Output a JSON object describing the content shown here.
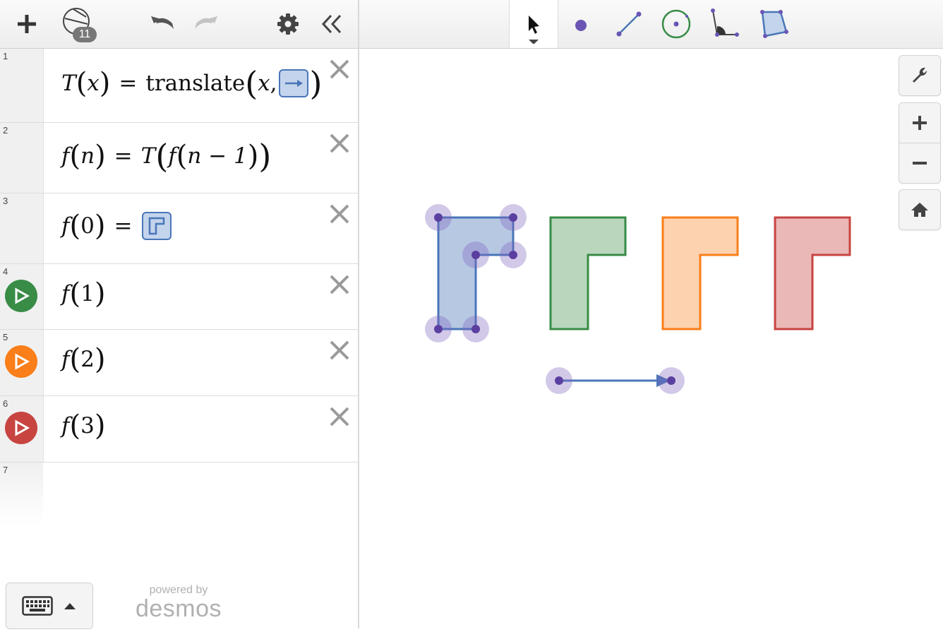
{
  "left_toolbar": {
    "add_icon": "plus-icon",
    "geometry_icon": "geometry-icon",
    "geometry_count": "11",
    "undo_icon": "undo-icon",
    "redo_icon": "redo-icon",
    "settings_icon": "gear-icon",
    "collapse_icon": "double-chevron-left-icon"
  },
  "expressions": [
    {
      "number": "1",
      "f": "T",
      "arg": "x",
      "eq": "=",
      "fn": "translate",
      "a1": "x",
      "a1sep": ","
    },
    {
      "number": "2",
      "lhs_f": "f",
      "lhs_arg": "n",
      "eq": "=",
      "T": "T",
      "inner_f": "f",
      "inner_arg": "n − 1"
    },
    {
      "number": "3",
      "f": "f",
      "arg": "0",
      "eq": "="
    },
    {
      "number": "4",
      "f": "f",
      "arg": "1",
      "color": "#388c46"
    },
    {
      "number": "5",
      "f": "f",
      "arg": "2",
      "color": "#fa7e19"
    },
    {
      "number": "6",
      "f": "f",
      "arg": "3",
      "color": "#c74440"
    },
    {
      "number": "7"
    }
  ],
  "footer": {
    "keyboard_icon": "keyboard-icon",
    "caret_icon": "caret-up-icon",
    "powered_by": "powered by",
    "brand": "desmos"
  },
  "graph_toolbar": {
    "tools": [
      "pointer-icon",
      "point-icon",
      "segment-icon",
      "circle-icon",
      "angle-icon",
      "polygon-icon"
    ]
  },
  "graph_controls": [
    "wrench-icon",
    "zoom-in-icon",
    "zoom-out-icon",
    "home-icon"
  ],
  "colors": {
    "blue": "#4a76b8",
    "green": "#388c46",
    "orange": "#fa7e19",
    "red": "#c74440",
    "point": "#5b3fa0",
    "point_halo": "#b9acd9"
  }
}
